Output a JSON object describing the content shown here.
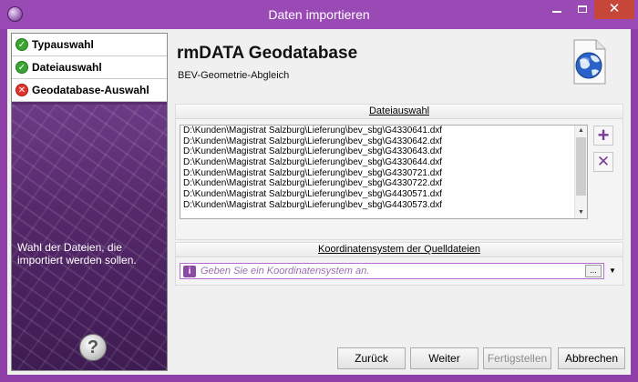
{
  "window": {
    "title": "Daten importieren",
    "close_glyph": "✕"
  },
  "steps": [
    {
      "label": "Typauswahl",
      "status": "ok",
      "glyph": "✓"
    },
    {
      "label": "Dateiauswahl",
      "status": "ok",
      "glyph": "✓"
    },
    {
      "label": "Geodatabase-Auswahl",
      "status": "error",
      "glyph": "✕"
    }
  ],
  "sidebar": {
    "hint": "Wahl der Dateien, die importiert werden sollen.",
    "help_glyph": "?"
  },
  "header": {
    "title": "rmDATA Geodatabase",
    "subtitle": "BEV-Geometrie-Abgleich",
    "icon": "globe-document-icon"
  },
  "file_group": {
    "label": "Dateiauswahl",
    "files": [
      "D:\\Kunden\\Magistrat Salzburg\\Lieferung\\bev_sbg\\G4330641.dxf",
      "D:\\Kunden\\Magistrat Salzburg\\Lieferung\\bev_sbg\\G4330642.dxf",
      "D:\\Kunden\\Magistrat Salzburg\\Lieferung\\bev_sbg\\G4330643.dxf",
      "D:\\Kunden\\Magistrat Salzburg\\Lieferung\\bev_sbg\\G4330644.dxf",
      "D:\\Kunden\\Magistrat Salzburg\\Lieferung\\bev_sbg\\G4330721.dxf",
      "D:\\Kunden\\Magistrat Salzburg\\Lieferung\\bev_sbg\\G4330722.dxf",
      "D:\\Kunden\\Magistrat Salzburg\\Lieferung\\bev_sbg\\G4430571.dxf",
      "D:\\Kunden\\Magistrat Salzburg\\Lieferung\\bev_sbg\\G4430573.dxf"
    ],
    "add_glyph": "+",
    "remove_glyph": "✕"
  },
  "crs_group": {
    "label": "Koordinatensystem der Quelldateien",
    "placeholder": "Geben Sie ein Koordinatensystem an.",
    "info_glyph": "i",
    "browse_label": "...",
    "dropdown_glyph": "▼"
  },
  "buttons": {
    "back": "Zurück",
    "next": "Weiter",
    "finish": "Fertigstellen",
    "cancel": "Abbrechen"
  },
  "colors": {
    "accent": "#9a4ab5",
    "ok": "#3aa532",
    "error": "#e0332b"
  }
}
